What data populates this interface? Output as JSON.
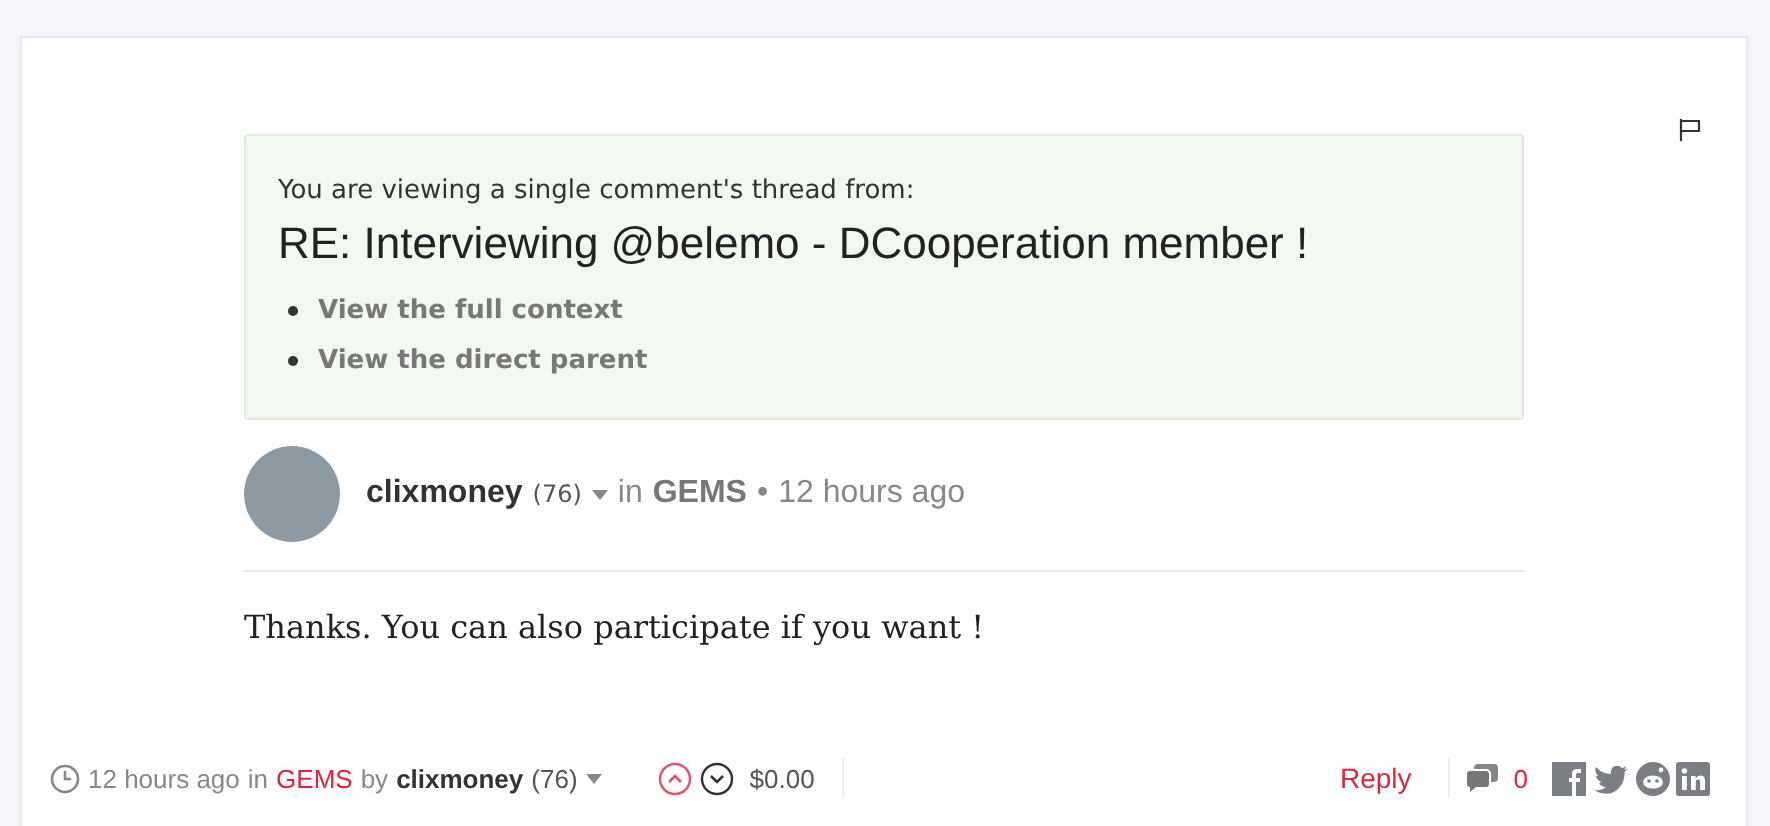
{
  "notice": {
    "intro": "You are viewing a single comment's thread from:",
    "title": "RE: Interviewing @belemo - DCooperation member !",
    "links": [
      "View the full context",
      "View the direct parent"
    ]
  },
  "comment": {
    "author": "clixmoney",
    "reputation": "(76)",
    "in_word": "in",
    "community": "GEMS",
    "separator": "•",
    "time": "12 hours ago",
    "body": "Thanks. You can also participate if you want !"
  },
  "footer": {
    "time": "12 hours ago",
    "in_word": "in",
    "community": "GEMS",
    "by_word": "by",
    "author": "clixmoney",
    "reputation": "(76)",
    "payout": "$0.00",
    "reply": "Reply",
    "comment_count": "0"
  }
}
